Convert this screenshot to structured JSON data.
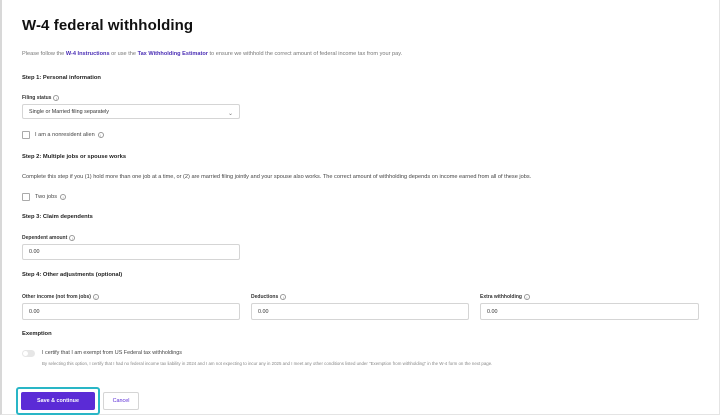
{
  "page": {
    "title": "W-4 federal withholding",
    "intro_prefix": "Please follow the ",
    "intro_link1": "W-4 Instructions",
    "intro_mid": " or use the ",
    "intro_link2": "Tax Withholding Estimator",
    "intro_suffix": " to ensure we withhold the correct amount of federal income tax from your pay."
  },
  "step1": {
    "heading": "Step 1: Personal information",
    "filing_status_label": "Filing status",
    "filing_status_value": "Single or Married filing separately",
    "nonresident_label": "I am a nonresident alien"
  },
  "step2": {
    "heading": "Step 2: Multiple jobs or spouse works",
    "description": "Complete this step if you (1) hold more than one job at a time, or (2) are married filing jointly and your spouse also works. The correct amount of withholding depends on income earned from all of these jobs.",
    "two_jobs_label": "Two jobs"
  },
  "step3": {
    "heading": "Step 3: Claim dependents",
    "dependent_amount_label": "Dependent amount",
    "dependent_amount_value": "0.00"
  },
  "step4": {
    "heading": "Step 4: Other adjustments (optional)",
    "other_income_label": "Other income (not from jobs)",
    "other_income_value": "0.00",
    "deductions_label": "Deductions",
    "deductions_value": "0.00",
    "extra_withholding_label": "Extra withholding",
    "extra_withholding_value": "0.00"
  },
  "exemption": {
    "heading": "Exemption",
    "certify_label": "I certify that I am exempt from US Federal tax withholdings",
    "certify_sub": "By selecting this option, I certify that I had no federal income tax liability in 2024 and I am not expecting to incur any in 2025 and I meet any other conditions listed under \"Exemption from withholding\" in the W-4 form on the next page."
  },
  "actions": {
    "save_label": "Save & continue",
    "cancel_label": "Cancel"
  },
  "icons": {
    "info": "info-icon",
    "chevron": "chevron-down-icon"
  },
  "colors": {
    "primary": "#5b2bd6",
    "focus_ring": "#29b6c6",
    "link": "#4b2fb5"
  }
}
